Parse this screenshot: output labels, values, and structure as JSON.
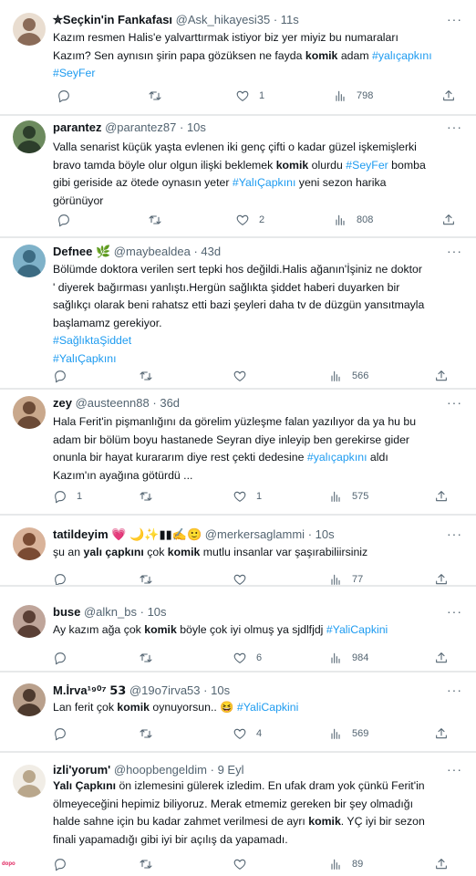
{
  "tweets": [
    {
      "name": "✮Seçkin'in Fankafası",
      "handle": "@Ask_hikayesi35",
      "dot": "·",
      "time": "11s",
      "avatar": [
        "#e9ddd0",
        "#8a6b58"
      ],
      "lines": [
        [
          {
            "t": "Kazım resmen Halis'e yalvarttırmak istiyor biz yer miyiz bu numaraları"
          }
        ],
        [
          {
            "t": "Kazım? Sen aynısın şirin papa gözüksen ne fayda "
          },
          {
            "t": "komik",
            "s": "b"
          },
          {
            "t": " adam "
          },
          {
            "t": "#yalıçapkını",
            "s": "tag"
          }
        ],
        [
          {
            "t": "#SeyFer",
            "s": "tag"
          }
        ]
      ],
      "counts": {
        "reply": "",
        "retweet": "",
        "like": "1",
        "views": "798"
      }
    },
    {
      "name": "parantez",
      "handle": "@parantez87",
      "dot": "·",
      "time": "10s",
      "avatar": [
        "#6c8a5e",
        "#2c3e2b"
      ],
      "lines": [
        [
          {
            "t": "Valla senarist küçük yaşta evlenen iki genç çifti o kadar güzel işkemişlerki"
          }
        ],
        [
          {
            "t": "bravo tamda böyle olur olgun ilişki beklemek "
          },
          {
            "t": "komik",
            "s": "b"
          },
          {
            "t": " olurdu "
          },
          {
            "t": "#SeyFer",
            "s": "tag"
          },
          {
            "t": " bomba"
          }
        ],
        [
          {
            "t": "gibi geriside az ötede oynasın yeter "
          },
          {
            "t": "#YalıÇapkını",
            "s": "tag"
          },
          {
            "t": " yeni sezon harika"
          }
        ],
        [
          {
            "t": "görünüyor"
          }
        ]
      ],
      "counts": {
        "reply": "",
        "retweet": "",
        "like": "2",
        "views": "808"
      }
    },
    {
      "name": "Defnee",
      "name_emoji": "🌿",
      "handle": "@maybealdea",
      "dot": "·",
      "time": "43d",
      "avatar": [
        "#7fb2c9",
        "#3c6b82"
      ],
      "lines": [
        [
          {
            "t": "Bölümde  doktora verilen sert tepki hos değildi.Halis ağanın'İşiniz ne doktor"
          }
        ],
        [
          {
            "t": "' diyerek bağırması yanlıştı.Hergün sağlıkta şiddet haberi duyarken bir"
          }
        ],
        [
          {
            "t": "sağlıkçı olarak beni rahatsz etti bazi şeyleri daha tv de düzgün yansıtmayla"
          }
        ],
        [
          {
            "t": "başlamamz gerekiyor."
          }
        ],
        [
          {
            "t": "#SağlıktaŞiddet",
            "s": "tag"
          }
        ],
        [
          {
            "t": "#YalıÇapkını",
            "s": "tag"
          }
        ]
      ],
      "counts": {
        "reply": "",
        "retweet": "",
        "like": "",
        "views": "566"
      }
    },
    {
      "name": "zey",
      "handle": "@austeenn88",
      "dot": "·",
      "time": "36d",
      "avatar": [
        "#c9a88c",
        "#6b4a36"
      ],
      "lines": [
        [
          {
            "t": "Hala Ferit'in pişmanlığını da görelim yüzleşme falan yazılıyor da ya hu bu"
          }
        ],
        [
          {
            "t": "adam bir bölüm boyu hastanede Seyran diye inleyip ben gerekirse gider"
          }
        ],
        [
          {
            "t": "onunla bir hayat kurararım diye rest çekti dedesine "
          },
          {
            "t": "#yalıçapkını",
            "s": "tag"
          },
          {
            "t": " aldı"
          }
        ],
        [
          {
            "t": "Kazım'ın ayağına götürdü ..."
          }
        ]
      ],
      "counts": {
        "reply": "1",
        "retweet": "",
        "like": "1",
        "views": "575"
      }
    },
    {
      "name": "tatildeyim",
      "name_emoji": "💗 🌙✨▮▮✍🙂",
      "handle": "@merkersaglammi",
      "dot": "·",
      "time": "10s",
      "avatar": [
        "#d9b39a",
        "#7a4b33"
      ],
      "lines": [
        [
          {
            "t": "şu an "
          },
          {
            "t": "yalı çapkını",
            "s": "b"
          },
          {
            "t": " çok "
          },
          {
            "t": "komik",
            "s": "b"
          },
          {
            "t": " mutlu insanlar var şaşırabiliirsiniz"
          }
        ]
      ],
      "counts": {
        "reply": "",
        "retweet": "",
        "like": "",
        "views": "77"
      }
    },
    {
      "name": "buse",
      "handle": "@alkn_bs",
      "dot": "·",
      "time": "10s",
      "avatar": [
        "#bfa59a",
        "#5a3f35"
      ],
      "lines": [
        [
          {
            "t": "Ay kazım ağa çok "
          },
          {
            "t": "komik",
            "s": "b"
          },
          {
            "t": " böyle çok iyi olmuş ya sjdlfjdj "
          },
          {
            "t": "#YaliCapkini",
            "s": "tag"
          }
        ]
      ],
      "counts": {
        "reply": "",
        "retweet": "",
        "like": "6",
        "views": "984"
      }
    },
    {
      "name": "M.İrva¹⁹⁰⁷ 𝟱𝟯",
      "handle": "@19o7irva53",
      "dot": "·",
      "time": "10s",
      "avatar": [
        "#b9a08c",
        "#4d3a2e"
      ],
      "lines": [
        [
          {
            "t": "Lan ferit çok "
          },
          {
            "t": "komik",
            "s": "b"
          },
          {
            "t": " oynuyorsun.. 😆 "
          },
          {
            "t": "#YaliCapkini",
            "s": "tag"
          }
        ]
      ],
      "counts": {
        "reply": "",
        "retweet": "",
        "like": "4",
        "views": "569"
      }
    },
    {
      "name": "izli'yorum'",
      "handle": "@hoopbengeldim",
      "dot": "·",
      "time": "9 Eyl",
      "avatar": [
        "#f1ede6",
        "#b9a78c"
      ],
      "lines": [
        [
          {
            "t": "Yalı Çapkını",
            "s": "b"
          },
          {
            "t": " ön izlemesini gülerek izledim. En ufak dram yok çünkü Ferit'in"
          }
        ],
        [
          {
            "t": "ölmeyeceğini hepimiz biliyoruz. Merak etmemiz gereken bir şey olmadığı"
          }
        ],
        [
          {
            "t": "halde sahne için bu kadar zahmet verilmesi de ayrı "
          },
          {
            "t": "komik",
            "s": "b"
          },
          {
            "t": ". YÇ iyi bir sezon"
          }
        ],
        [
          {
            "t": "finali yapamadığı gibi iyi bir açılış da yapamadı."
          }
        ]
      ],
      "counts": {
        "reply": "",
        "retweet": "",
        "like": "",
        "views": "89"
      }
    }
  ],
  "watermark": "dopo",
  "colors": {
    "accent": "#1d9bf0",
    "text": "#0f1419",
    "muted": "#536471",
    "separator": "#e7e9ea"
  }
}
